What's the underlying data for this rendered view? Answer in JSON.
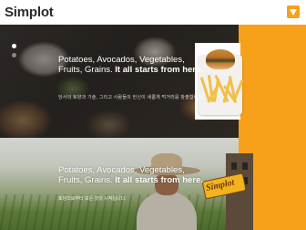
{
  "brand": {
    "logo_text": "Simplot"
  },
  "colors": {
    "accent": "#f7a11a",
    "text_on_image": "#ffffff"
  },
  "hero1": {
    "tagline": "Potatoes, Avocados, Vegetables, Fruits, Grains.",
    "tagline_bold": "It all starts from here.",
    "subtext": "당사의 토양과 기술, 그리고 사람들의 헌신이 새롭게 먹거리를 창출합니다."
  },
  "hero2": {
    "tagline": "Potatoes, Avocados, Vegetables, Fruits, Grains.",
    "tagline_bold": "It all starts from here.",
    "subtext": "토양으로부터 모든 것이 시작됩니다.",
    "sign_text": "Simplot"
  },
  "pager": {
    "total": 2,
    "active": 1
  },
  "icons": {
    "logo_mark": "simplot-mark-icon"
  }
}
